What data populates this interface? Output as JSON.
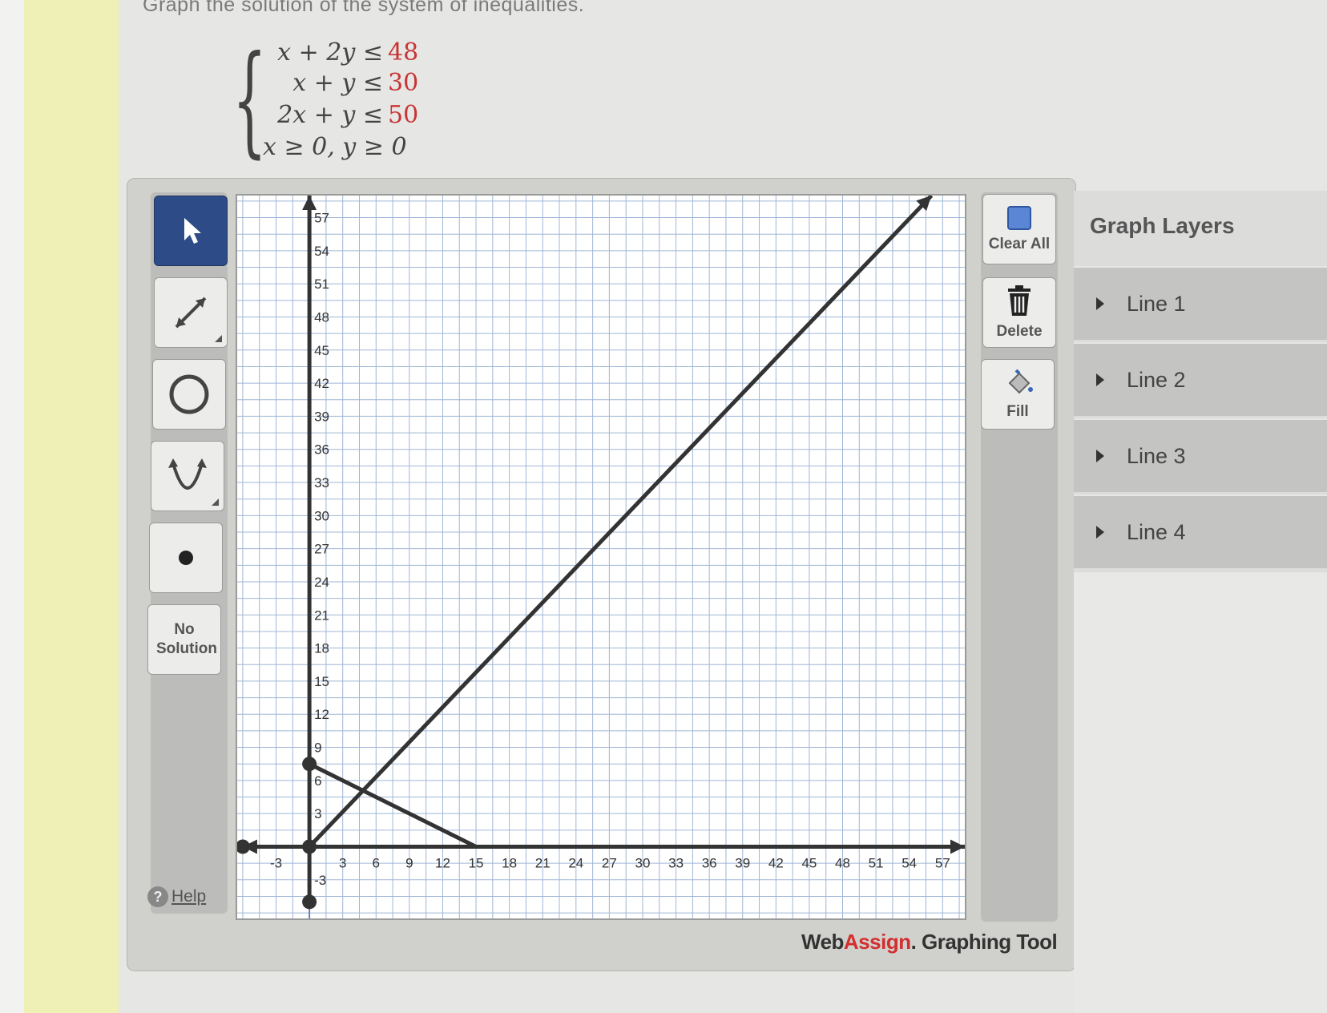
{
  "question": {
    "title": "Graph the solution of the system of inequalities.",
    "inequalities": [
      {
        "lhs": "x + 2y ≤",
        "rhs": "48"
      },
      {
        "lhs": "x +   y ≤",
        "rhs": "30"
      },
      {
        "lhs": "2x +   y ≤",
        "rhs": "50"
      },
      {
        "lhs": "x ≥ 0,  y ≥ 0",
        "rhs": ""
      }
    ]
  },
  "toolbar": {
    "tools": [
      {
        "name": "select-tool",
        "icon": "pointer-arrow-icon"
      },
      {
        "name": "line-tool",
        "icon": "line-arrows-icon"
      },
      {
        "name": "circle-tool",
        "icon": "circle-icon"
      },
      {
        "name": "parabola-tool",
        "icon": "parabola-icon"
      },
      {
        "name": "point-tool",
        "icon": "point-icon"
      }
    ],
    "no_solution_label": "No Solution",
    "help_label": "Help"
  },
  "actions": {
    "clear_all_label": "Clear All",
    "delete_label": "Delete",
    "fill_label": "Fill"
  },
  "graph": {
    "x_ticks": [
      "-3",
      "3",
      "6",
      "9",
      "12",
      "15",
      "18",
      "21",
      "24",
      "27",
      "30",
      "33",
      "36",
      "39",
      "42",
      "45",
      "48",
      "51",
      "54",
      "57"
    ],
    "y_ticks": [
      "-3",
      "3",
      "6",
      "9",
      "12",
      "15",
      "18",
      "21",
      "24",
      "27",
      "30",
      "33",
      "36",
      "39",
      "42",
      "45",
      "48",
      "51",
      "54",
      "57"
    ],
    "x_range": [
      -6.5,
      59
    ],
    "y_range": [
      -6.5,
      59
    ],
    "lines_drawn": [
      {
        "points": [
          [
            0,
            0
          ],
          [
            56,
            59
          ]
        ],
        "note": "line through origin"
      },
      {
        "points": [
          [
            0,
            7.5
          ],
          [
            15,
            0
          ]
        ],
        "note": "decreasing line"
      },
      {
        "points": [
          [
            0,
            -5
          ],
          [
            0,
            59
          ]
        ],
        "note": "vertical line x=0"
      },
      {
        "points": [
          [
            -6,
            0
          ],
          [
            59,
            0
          ]
        ],
        "note": "x-axis line"
      }
    ]
  },
  "brand": {
    "web": "Web",
    "assign": "Assign",
    "rest": ". Graphing Tool"
  },
  "layers": {
    "title": "Graph Layers",
    "items": [
      "Line 1",
      "Line 2",
      "Line 3",
      "Line 4"
    ]
  },
  "colors": {
    "accent_red": "#c93535",
    "active_tool": "#2d4b86",
    "line": "#333333",
    "axis_blue": "#6a7fb8"
  }
}
